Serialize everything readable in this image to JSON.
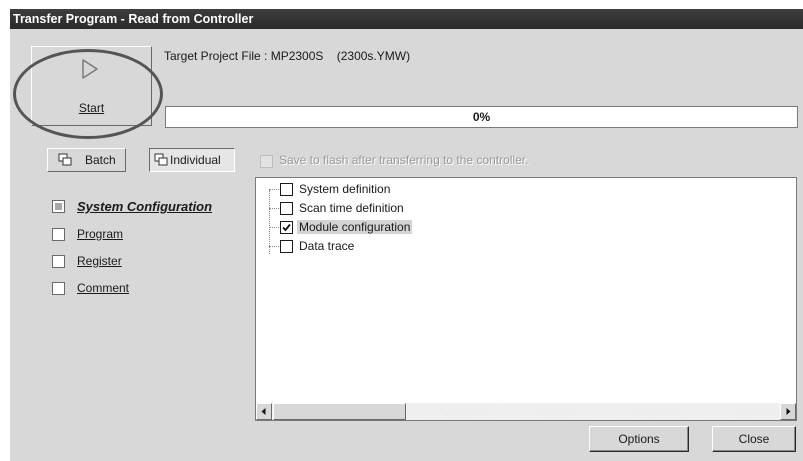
{
  "window": {
    "title": "Transfer Program - Read from Controller"
  },
  "start": {
    "label": "Start",
    "icon": "play-icon"
  },
  "target": {
    "text": "Target Project File : MP2300S    (2300s.YMW)"
  },
  "progress": {
    "value": 0,
    "label": "0%"
  },
  "mode": {
    "batch_label": "Batch",
    "individual_label": "Individual",
    "selected": "Individual"
  },
  "flash": {
    "label": "Save to flash after transferring to the controller.",
    "checked": false,
    "enabled": false
  },
  "categories": [
    {
      "label": "System Configuration",
      "state": "partial",
      "active": true
    },
    {
      "label": "Program",
      "state": "unchecked",
      "active": false
    },
    {
      "label": "Register",
      "state": "unchecked",
      "active": false
    },
    {
      "label": "Comment",
      "state": "unchecked",
      "active": false
    }
  ],
  "tree": {
    "items": [
      {
        "label": "System definition",
        "checked": false,
        "selected": false
      },
      {
        "label": "Scan time definition",
        "checked": false,
        "selected": false
      },
      {
        "label": "Module configuration",
        "checked": true,
        "selected": true
      },
      {
        "label": "Data trace",
        "checked": false,
        "selected": false
      }
    ]
  },
  "buttons": {
    "options": "Options",
    "close": "Close"
  },
  "colors": {
    "titlebar": "#353535",
    "face": "#d8d8d8",
    "annotation_ring": "#555555"
  }
}
